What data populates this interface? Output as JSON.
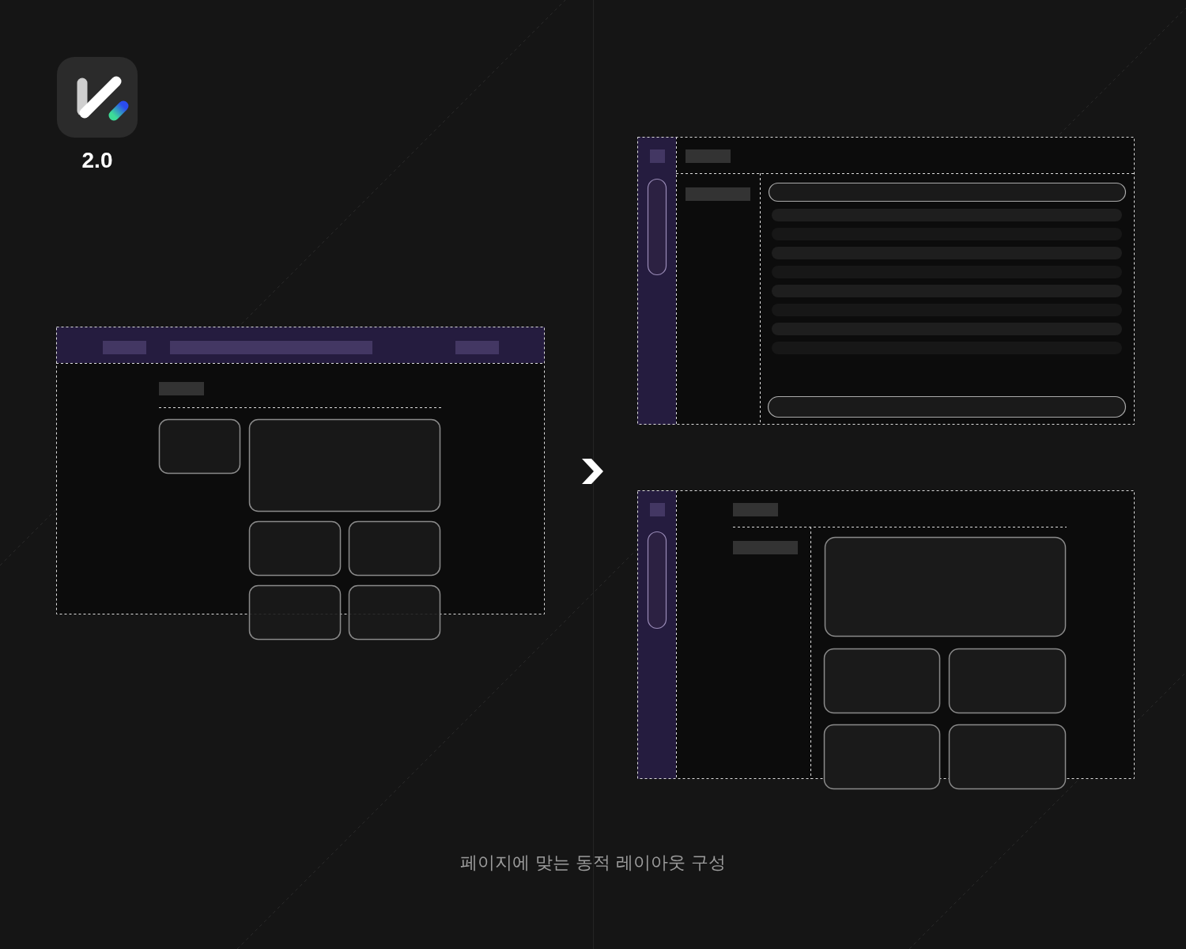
{
  "app": {
    "version": "2.0"
  },
  "caption": "페이지에 맞는 동적 레이아웃 구성"
}
